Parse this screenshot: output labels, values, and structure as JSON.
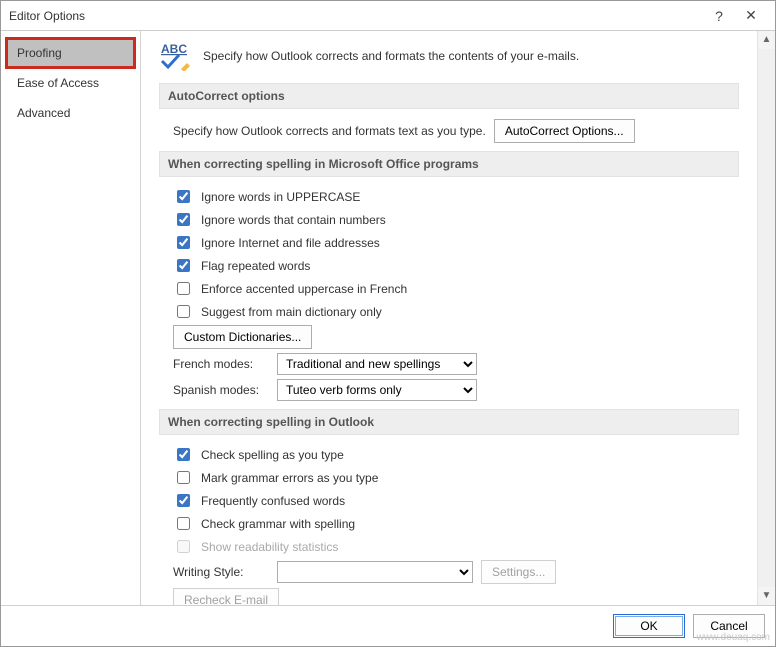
{
  "window": {
    "title": "Editor Options",
    "help_icon": "?",
    "close_icon": "✕"
  },
  "sidebar": {
    "items": [
      {
        "label": "Proofing"
      },
      {
        "label": "Ease of Access"
      },
      {
        "label": "Advanced"
      }
    ]
  },
  "main": {
    "header_text": "Specify how Outlook corrects and formats the contents of your e-mails.",
    "section_autocorrect": {
      "title": "AutoCorrect options",
      "desc": "Specify how Outlook corrects and formats text as you type.",
      "button": "AutoCorrect Options..."
    },
    "section_office": {
      "title": "When correcting spelling in Microsoft Office programs",
      "chk_uppercase": "Ignore words in UPPERCASE",
      "chk_numbers": "Ignore words that contain numbers",
      "chk_internet": "Ignore Internet and file addresses",
      "chk_repeated": "Flag repeated words",
      "chk_french": "Enforce accented uppercase in French",
      "chk_maindict": "Suggest from main dictionary only",
      "btn_custom": "Custom Dictionaries...",
      "french_label": "French modes:",
      "french_value": "Traditional and new spellings",
      "spanish_label": "Spanish modes:",
      "spanish_value": "Tuteo verb forms only"
    },
    "section_outlook": {
      "title": "When correcting spelling in Outlook",
      "chk_checkspell": "Check spelling as you type",
      "chk_grammar": "Mark grammar errors as you type",
      "chk_confused": "Frequently confused words",
      "chk_grammar_spell": "Check grammar with spelling",
      "chk_readability": "Show readability statistics",
      "writing_label": "Writing Style:",
      "writing_value": "",
      "btn_settings": "Settings...",
      "btn_recheck": "Recheck E-mail"
    }
  },
  "footer": {
    "ok": "OK",
    "cancel": "Cancel"
  },
  "watermark": "www.deuaq.com"
}
